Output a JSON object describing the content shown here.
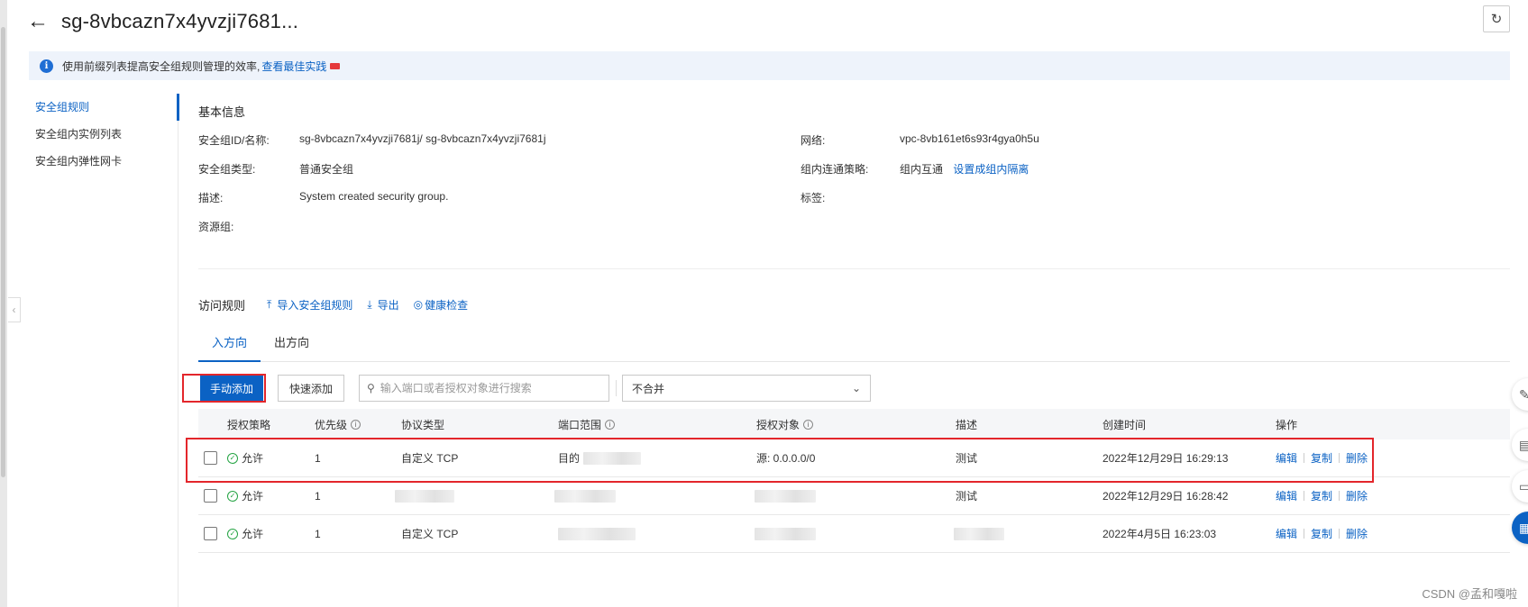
{
  "header": {
    "title": "sg-8vbcazn7x4yvzji7681...",
    "back_icon": "arrow-left-icon",
    "refresh_icon": "refresh-icon"
  },
  "notice": {
    "text": "使用前缀列表提高安全组规则管理的效率,",
    "link": "查看最佳实践"
  },
  "sidenav": {
    "items": [
      {
        "label": "安全组规则",
        "active": true
      },
      {
        "label": "安全组内实例列表",
        "active": false
      },
      {
        "label": "安全组内弹性网卡",
        "active": false
      }
    ]
  },
  "basic_info": {
    "title": "基本信息",
    "fields": [
      {
        "label": "安全组ID/名称:",
        "value": "sg-8vbcazn7x4yvzji7681j/ sg-8vbcazn7x4yvzji7681j"
      },
      {
        "label": "网络:",
        "value": "vpc-8vb161et6s93r4gya0h5u"
      },
      {
        "label": "安全组类型:",
        "value": "普通安全组"
      },
      {
        "label": "组内连通策略:",
        "value": "组内互通",
        "link": "设置成组内隔离"
      },
      {
        "label": "描述:",
        "value": "System created security group."
      },
      {
        "label": "标签:",
        "value": ""
      },
      {
        "label": "资源组:",
        "value": ""
      }
    ]
  },
  "rules": {
    "title": "访问规则",
    "actions": [
      "导入安全组规则",
      "导出",
      "健康检查"
    ],
    "tabs": [
      {
        "label": "入方向",
        "active": true
      },
      {
        "label": "出方向",
        "active": false
      }
    ],
    "toolbar": {
      "manual_add": "手动添加",
      "quick_add": "快速添加",
      "search_placeholder": "输入端口或者授权对象进行搜索",
      "merge_select": "不合并"
    },
    "columns": [
      "授权策略",
      "优先级",
      "协议类型",
      "端口范围",
      "授权对象",
      "描述",
      "创建时间",
      "操作"
    ],
    "rows": [
      {
        "policy": "允许",
        "priority": "1",
        "protocol": "自定义 TCP",
        "port": "目的",
        "source": "源: 0.0.0.0/0",
        "desc": "测试",
        "created": "2022年12月29日 16:29:13"
      },
      {
        "policy": "允许",
        "priority": "1",
        "protocol": "",
        "port": "",
        "source": "",
        "desc": "测试",
        "created": "2022年12月29日 16:28:42"
      },
      {
        "policy": "允许",
        "priority": "1",
        "protocol": "自定义 TCP",
        "port": "",
        "source": "",
        "desc": "",
        "created": "2022年4月5日 16:23:03"
      }
    ],
    "ops": [
      "编辑",
      "复制",
      "删除"
    ]
  },
  "watermark": "CSDN @孟和嘎啦"
}
